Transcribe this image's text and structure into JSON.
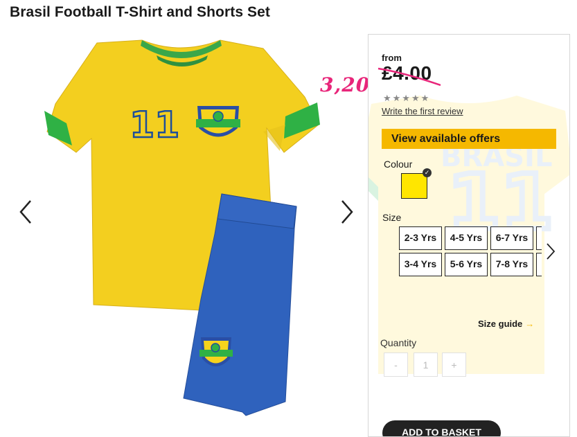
{
  "product": {
    "title": "Brasil Football T-Shirt and Shorts Set",
    "price_prefix": "from",
    "price": "£4.00",
    "annotation": "3,20",
    "rating_stars": "★★★★★",
    "review_link": "Write the first review",
    "offers_button": "View available offers",
    "colour_label": "Colour",
    "selected_colour": "#ffe600",
    "accent_color": "#f5b800",
    "strike_color": "#e8267a",
    "size_label": "Size",
    "sizes": [
      "2-3 Yrs",
      "4-5 Yrs",
      "6-7 Yrs",
      "3-4 Yrs",
      "5-6 Yrs",
      "7-8 Yrs"
    ],
    "size_guide": "Size guide",
    "quantity_label": "Quantity",
    "quantity_minus": "-",
    "quantity_value": "1",
    "quantity_plus": "+",
    "add_to_basket": "ADD TO BASKET"
  },
  "shirt": {
    "number": "11",
    "badge_text": "BRASIL"
  }
}
